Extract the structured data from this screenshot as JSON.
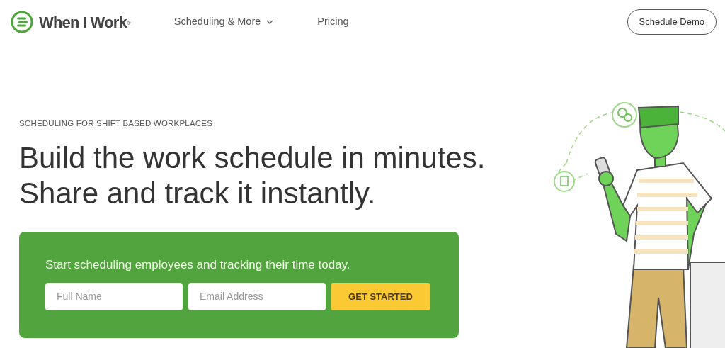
{
  "brand": {
    "name": "When I Work",
    "mark": "$^{®}$"
  },
  "nav": [
    {
      "label": "Scheduling & More",
      "dropdown": true
    },
    {
      "label": "Pricing",
      "dropdown": false
    }
  ],
  "demo_button": "Schedule Demo",
  "hero": {
    "eyebrow": "SCHEDULING FOR SHIFT BASED WORKPLACES",
    "headline": [
      "Build the work schedule in minutes.",
      "Share and track it instantly."
    ]
  },
  "signup": {
    "prompt": "Start scheduling employees and tracking their time today.",
    "fields": [
      {
        "placeholder": "Full Name"
      },
      {
        "placeholder": "Email Address"
      }
    ],
    "button": "GET STARTED"
  }
}
